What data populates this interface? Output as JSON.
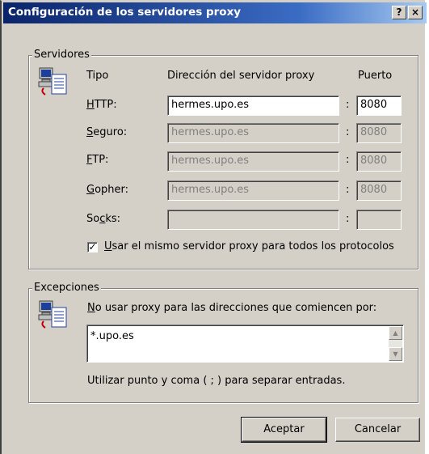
{
  "window": {
    "title": "Configuración de los servidores proxy",
    "help_label": "?",
    "close_label": "×"
  },
  "servers": {
    "legend": "Servidores",
    "col_type": "Tipo",
    "col_address": "Dirección del servidor proxy",
    "col_port": "Puerto",
    "separator": ":",
    "rows": [
      {
        "type_key": "H",
        "type_rest": "TTP:",
        "address": "hermes.upo.es",
        "port": "8080",
        "enabled": true
      },
      {
        "type_key": "S",
        "type_rest": "eguro:",
        "address": "hermes.upo.es",
        "port": "8080",
        "enabled": false
      },
      {
        "type_key": "F",
        "type_rest": "TP:",
        "address": "hermes.upo.es",
        "port": "8080",
        "enabled": false
      },
      {
        "type_key": "G",
        "type_rest": "opher:",
        "address": "hermes.upo.es",
        "port": "8080",
        "enabled": false
      },
      {
        "type_pre": "So",
        "type_key": "c",
        "type_rest": "ks:",
        "address": "",
        "port": "",
        "enabled": false
      }
    ],
    "same_proxy": {
      "checked": true,
      "mark": "✓",
      "key": "U",
      "rest": "sar el mismo servidor proxy para todos los protocolos"
    }
  },
  "exceptions": {
    "legend": "Excepciones",
    "desc_key": "N",
    "desc_rest": "o usar proxy para las direcciones que comiencen por:",
    "value": "*.upo.es",
    "hint": "Utilizar punto y coma ( ; ) para separar entradas.",
    "scroll_up": "▲",
    "scroll_down": "▼"
  },
  "buttons": {
    "accept": "Aceptar",
    "cancel": "Cancelar"
  },
  "colors": {
    "title_bar_start": "#0a246a",
    "dialog_bg": "#d4d0c8",
    "disabled_text": "#808080"
  }
}
